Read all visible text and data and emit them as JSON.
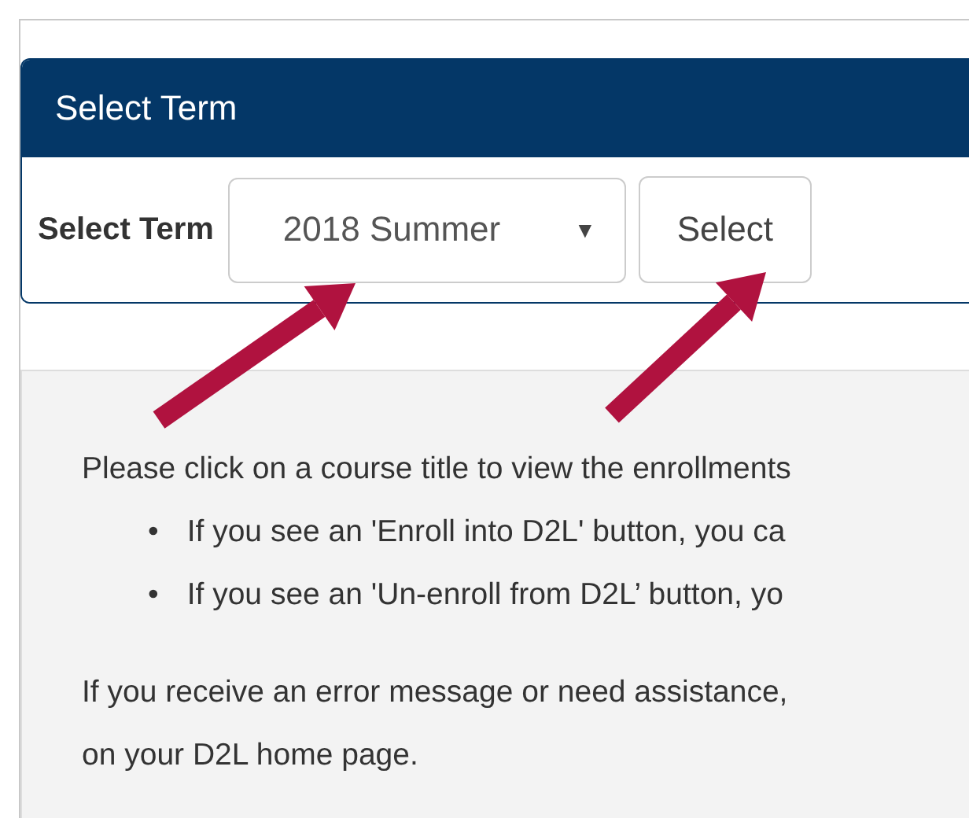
{
  "term_panel": {
    "title": "Select Term",
    "label": "Select Term",
    "term_select": {
      "value": "2018 Summer",
      "arrow": "▼"
    },
    "select_button": "Select"
  },
  "instructions": {
    "intro": "Please click on a course title to view the enrollments",
    "bullets": [
      {
        "marker": "•",
        "text": "If you see an 'Enroll into D2L' button, you ca"
      },
      {
        "marker": "•",
        "text": "If you see an 'Un-enroll from D2L’ button, yo"
      }
    ],
    "help_lines": [
      "If you receive an error message or need assistance,",
      "on your D2L home page."
    ]
  }
}
